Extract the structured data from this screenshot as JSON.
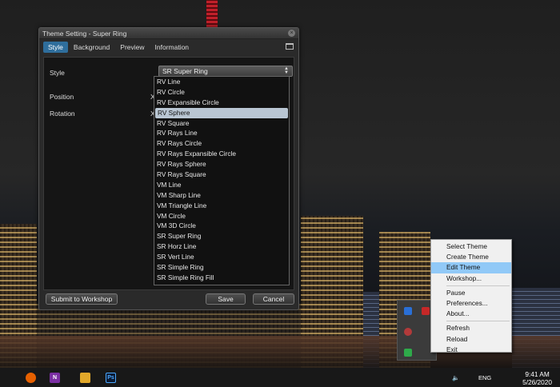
{
  "dialog": {
    "title": "Theme Setting - Super Ring",
    "tabs": [
      {
        "label": "Style",
        "active": true
      },
      {
        "label": "Background",
        "active": false
      },
      {
        "label": "Preview",
        "active": false
      },
      {
        "label": "Information",
        "active": false
      }
    ],
    "style_label": "Style",
    "style_value": "SR Super Ring",
    "position_label": "Position",
    "position_axis": "X",
    "rotation_label": "Rotation",
    "rotation_axis": "X",
    "dropdown_options": [
      "RV Line",
      "RV Circle",
      "RV Expansible Circle",
      "RV Sphere",
      "RV Square",
      "RV Rays Line",
      "RV Rays Circle",
      "RV Rays Expansible Circle",
      "RV Rays Sphere",
      "RV Rays Square",
      "VM Line",
      "VM Sharp Line",
      "VM Triangle Line",
      "VM Circle",
      "VM 3D Circle",
      "SR Super Ring",
      "SR Horz Line",
      "SR Vert Line",
      "SR Simple Ring",
      "SR Simple Ring Fill"
    ],
    "dropdown_selected": "RV Sphere",
    "submit_label": "Submit to Workshop",
    "save_label": "Save",
    "cancel_label": "Cancel"
  },
  "context_menu": {
    "group1": [
      "Select Theme",
      "Create Theme",
      "Edit Theme",
      "Workshop..."
    ],
    "group2": [
      "Pause",
      "Preferences...",
      "About..."
    ],
    "group3": [
      "Refresh",
      "Reload",
      "Exit"
    ],
    "highlighted": "Edit Theme"
  },
  "taskbar": {
    "language": "ENG",
    "time": "9:41 AM",
    "date": "5/26/2020",
    "icons": [
      "firefox-icon",
      "onenote-icon",
      "file-explorer-icon",
      "photoshop-icon"
    ],
    "onenote_letter": "N",
    "photoshop_letters": "Ps"
  },
  "colors": {
    "accent_tab": "#2f6e9c",
    "menu_highlight": "#91c9f7",
    "dropdown_selected": "#b9c6d3"
  }
}
